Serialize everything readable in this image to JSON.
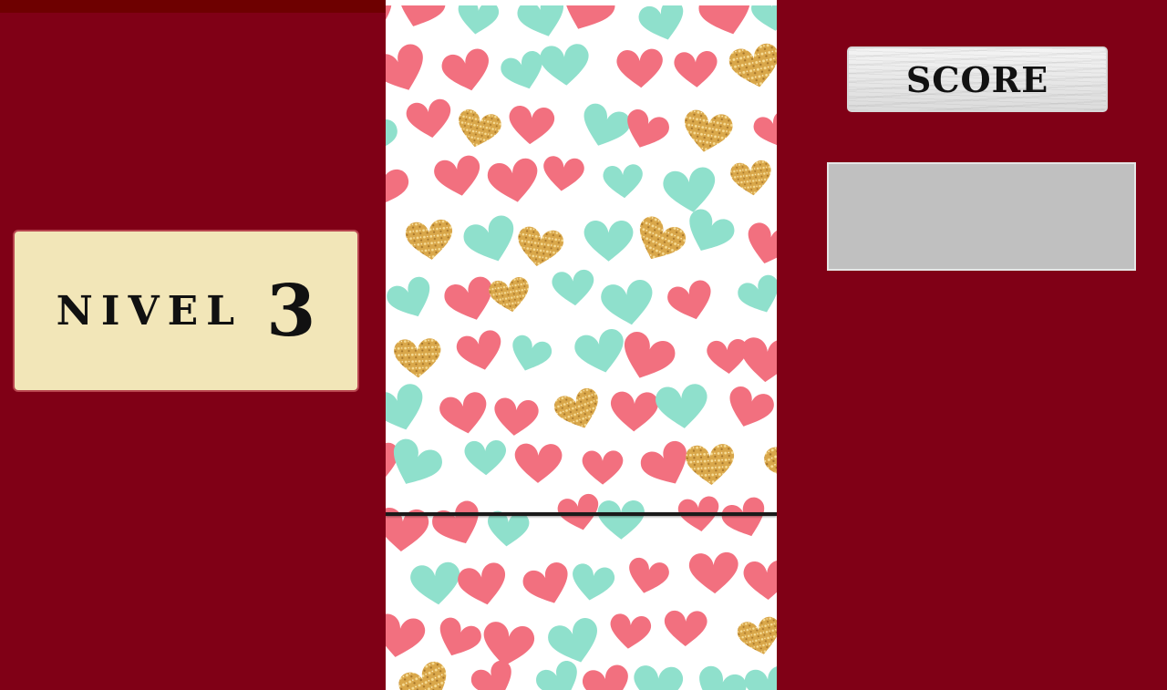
{
  "level": {
    "label": "NIVEL",
    "number": "3"
  },
  "score": {
    "label": "SCORE",
    "value": ""
  },
  "colors": {
    "side_panel": "#800016",
    "top_strip": "#6e0000",
    "level_box_bg": "#f2e6b8",
    "level_box_border": "#b8454f",
    "score_value_bg": "#c0c0c0",
    "heart_pink": "#f2707f",
    "heart_mint": "#8fe0cc",
    "heart_gold": "#d9a74a",
    "paddle": "#1a1a1a"
  },
  "icons": {
    "background_pattern": "heart-pattern-icon"
  }
}
